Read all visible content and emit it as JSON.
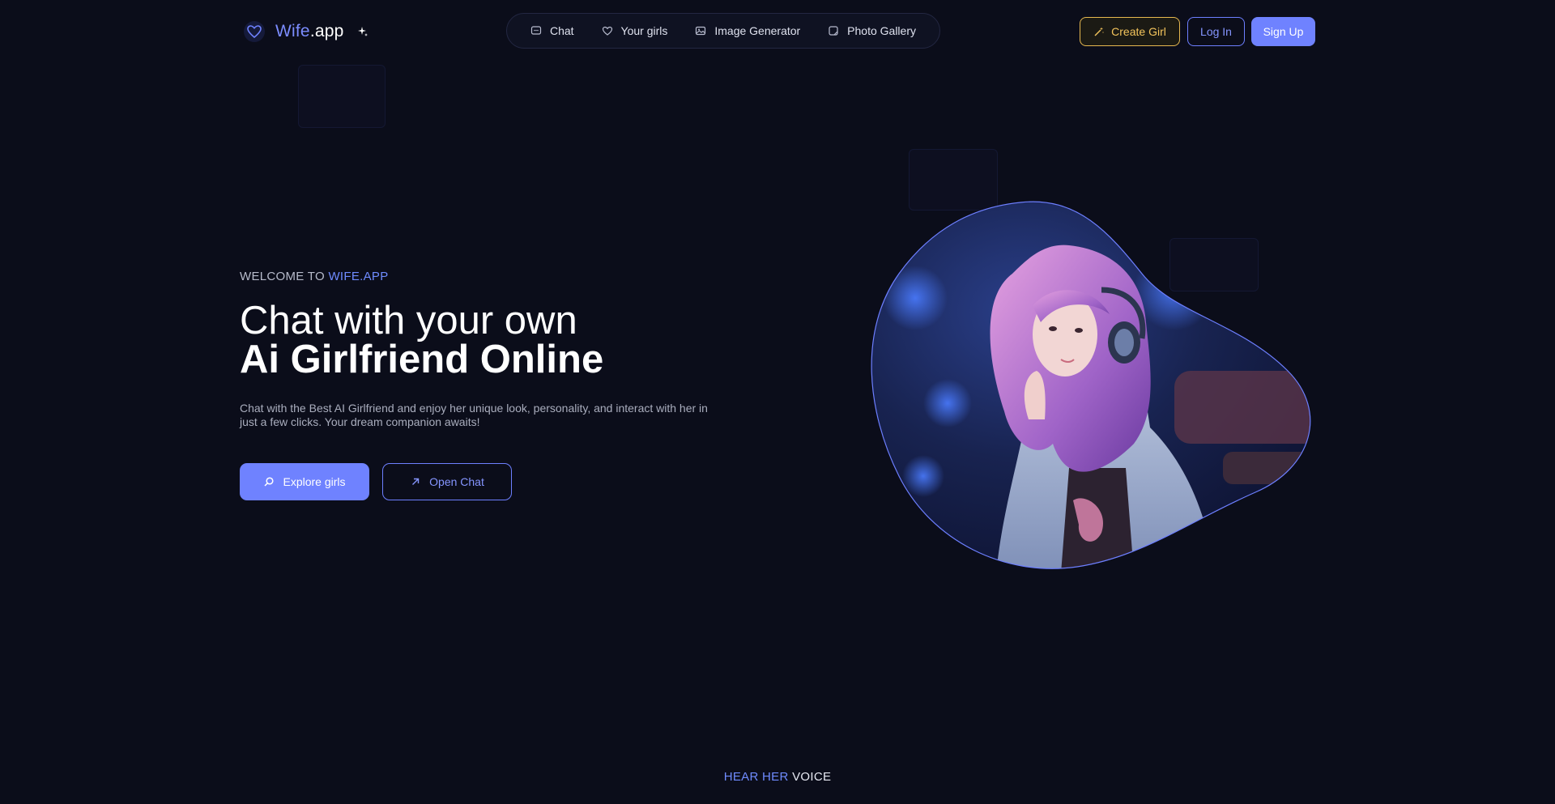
{
  "brand": {
    "name_accent": "Wife",
    "name_rest": ".app",
    "logo_icon": "heart-icon",
    "badge_icon": "sparkle-icon"
  },
  "nav": {
    "items": [
      {
        "label": "Chat",
        "icon": "chat-bubble-icon"
      },
      {
        "label": "Your girls",
        "icon": "heart-outline-icon"
      },
      {
        "label": "Image Generator",
        "icon": "image-icon"
      },
      {
        "label": "Photo Gallery",
        "icon": "gallery-icon"
      }
    ]
  },
  "header_actions": {
    "create": "Create Girl",
    "login": "Log In",
    "signup": "Sign Up"
  },
  "hero": {
    "welcome_prefix": "WELCOME TO ",
    "welcome_brand": "WIFE.APP",
    "title_line1": "Chat with your own",
    "title_line2": "Ai Girlfriend Online",
    "description": "Chat with the Best AI Girlfriend and enjoy her unique look, personality, and interact with her in just a few clicks. Your dream companion awaits!",
    "explore_button": "Explore girls",
    "open_chat_button": "Open Chat"
  },
  "voice_section": {
    "accent": "HEAR HER",
    "rest": " VOICE"
  },
  "colors": {
    "background": "#0b0d1a",
    "accent": "#6f82ff",
    "create_gold": "#e6b84f"
  }
}
